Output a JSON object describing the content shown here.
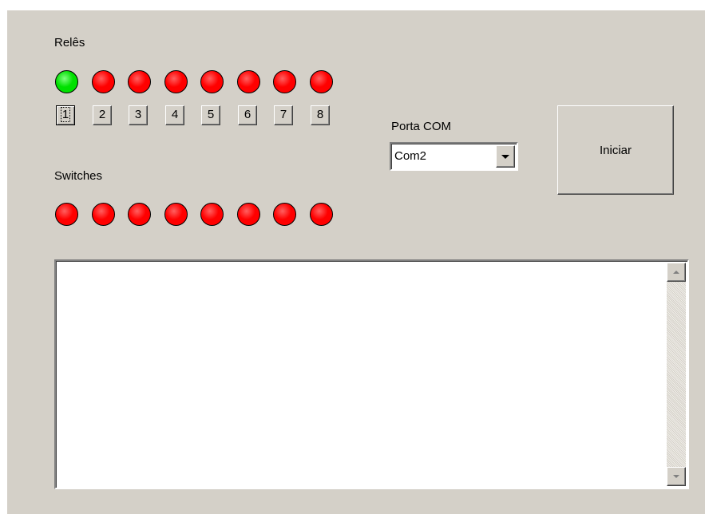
{
  "reles": {
    "title": "Relês",
    "leds": [
      {
        "state": "on",
        "color": "#00e000"
      },
      {
        "state": "off",
        "color": "#ff0000"
      },
      {
        "state": "off",
        "color": "#ff0000"
      },
      {
        "state": "off",
        "color": "#ff0000"
      },
      {
        "state": "off",
        "color": "#ff0000"
      },
      {
        "state": "off",
        "color": "#ff0000"
      },
      {
        "state": "off",
        "color": "#ff0000"
      },
      {
        "state": "off",
        "color": "#ff0000"
      }
    ],
    "buttons": [
      "1",
      "2",
      "3",
      "4",
      "5",
      "6",
      "7",
      "8"
    ]
  },
  "switches": {
    "title": "Switches",
    "leds": [
      {
        "state": "off",
        "color": "#ff0000"
      },
      {
        "state": "off",
        "color": "#ff0000"
      },
      {
        "state": "off",
        "color": "#ff0000"
      },
      {
        "state": "off",
        "color": "#ff0000"
      },
      {
        "state": "off",
        "color": "#ff0000"
      },
      {
        "state": "off",
        "color": "#ff0000"
      },
      {
        "state": "off",
        "color": "#ff0000"
      },
      {
        "state": "off",
        "color": "#ff0000"
      }
    ]
  },
  "port": {
    "label": "Porta COM",
    "selected": "Com2"
  },
  "start_button": "Iniciar",
  "log": {
    "text": ""
  }
}
